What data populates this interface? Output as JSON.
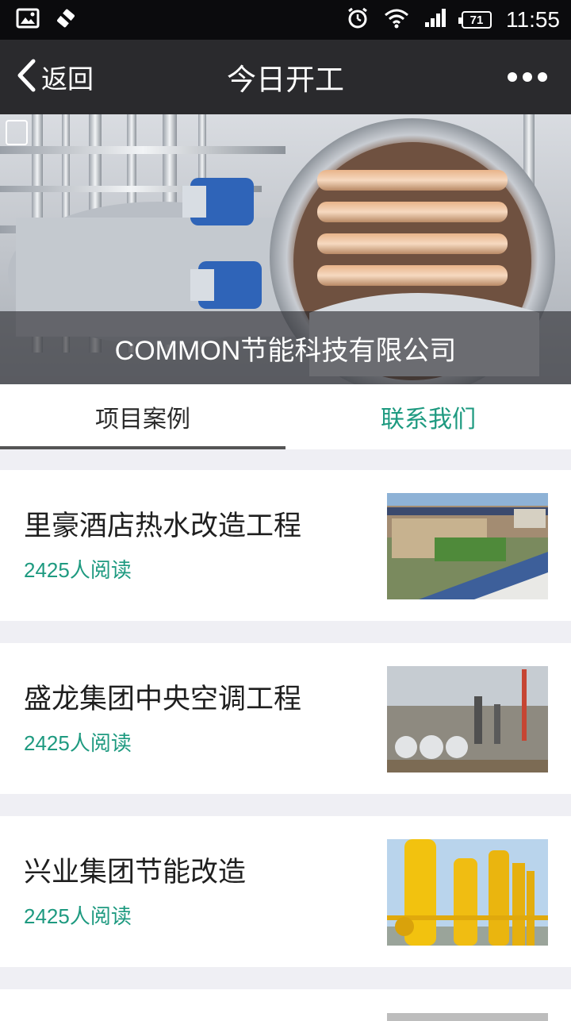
{
  "status_bar": {
    "time": "11:55",
    "battery": "71",
    "left_icons": [
      "image-icon",
      "no-sim-icon"
    ],
    "right_icons": [
      "alarm-icon",
      "wifi-icon",
      "signal-icon",
      "battery-icon"
    ]
  },
  "nav": {
    "back_label": "返回",
    "title": "今日开工",
    "more_icon": "more-dots-icon"
  },
  "banner": {
    "caption": "COMMON节能科技有限公司"
  },
  "tabs": [
    {
      "label": "项目案例",
      "active": true
    },
    {
      "label": "联系我们",
      "active": false
    }
  ],
  "items": [
    {
      "title": "里豪酒店热水改造工程",
      "reads": "2425人阅读"
    },
    {
      "title": "盛龙集团中央空调工程",
      "reads": "2425人阅读"
    },
    {
      "title": "兴业集团节能改造",
      "reads": "2425人阅读"
    }
  ],
  "colors": {
    "accent": "#1e9a80",
    "navbar": "#2a2a2d",
    "statusbar": "#0b0b0d",
    "page_bg": "#efeff4"
  }
}
